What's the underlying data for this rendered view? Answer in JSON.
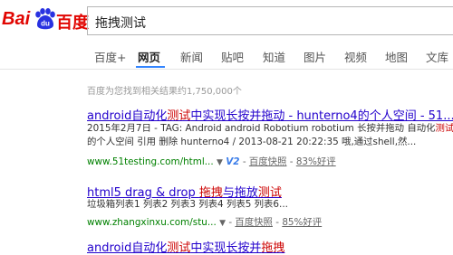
{
  "logo": {
    "bai": "Bai",
    "du": "du",
    "cn": "百度"
  },
  "search": {
    "query": "拖拽测试"
  },
  "tabs": [
    "百度+",
    "网页",
    "新闻",
    "贴吧",
    "知道",
    "图片",
    "视频",
    "地图",
    "文库"
  ],
  "active_tab": "网页",
  "stats": "百度为您找到相关结果约1,750,000个",
  "results": [
    {
      "title": [
        {
          "t": "android自动化"
        },
        {
          "t": "测试",
          "em": true
        },
        {
          "t": "中实现长按并拖动 - hunterno4的个人空间 - 51..."
        }
      ],
      "abstract": [
        [
          {
            "t": "2015年2月7日 - TAG: Android android Robotium robotium 长按并拖动 自动化"
          },
          {
            "t": "测试",
            "em": true
          }
        ],
        [
          {
            "t": "的个人空间 引用 删除 hunterno4 / 2013-08-21 20:22:35 哦,通过shell,然..."
          }
        ]
      ],
      "url": "www.51testing.com/html...",
      "badge": "V2",
      "snapshot": "百度快照",
      "sep": "-",
      "rating": "83%好评"
    },
    {
      "title": [
        {
          "t": "html5 drag & drop "
        },
        {
          "t": "拖拽",
          "em": true
        },
        {
          "t": "与拖放"
        },
        {
          "t": "测试",
          "em": true
        }
      ],
      "abstract": [
        [
          {
            "t": "垃圾箱列表1 列表2 列表3 列表4 列表5 列表6..."
          }
        ]
      ],
      "url": "www.zhangxinxu.com/stu...",
      "badge": "",
      "snapshot": "百度快照",
      "sep": "-",
      "rating": "85%好评"
    }
  ],
  "partial_result": [
    {
      "t": "android自动化"
    },
    {
      "t": "测试",
      "em": true
    },
    {
      "t": "中实现长按并"
    },
    {
      "t": "拖拽",
      "em": true
    }
  ],
  "colors": {
    "brand_red": "#e10602",
    "link_blue": "#2200cc",
    "url_green": "#008000",
    "highlight": "#c00",
    "tab_accent": "#3385ff"
  }
}
